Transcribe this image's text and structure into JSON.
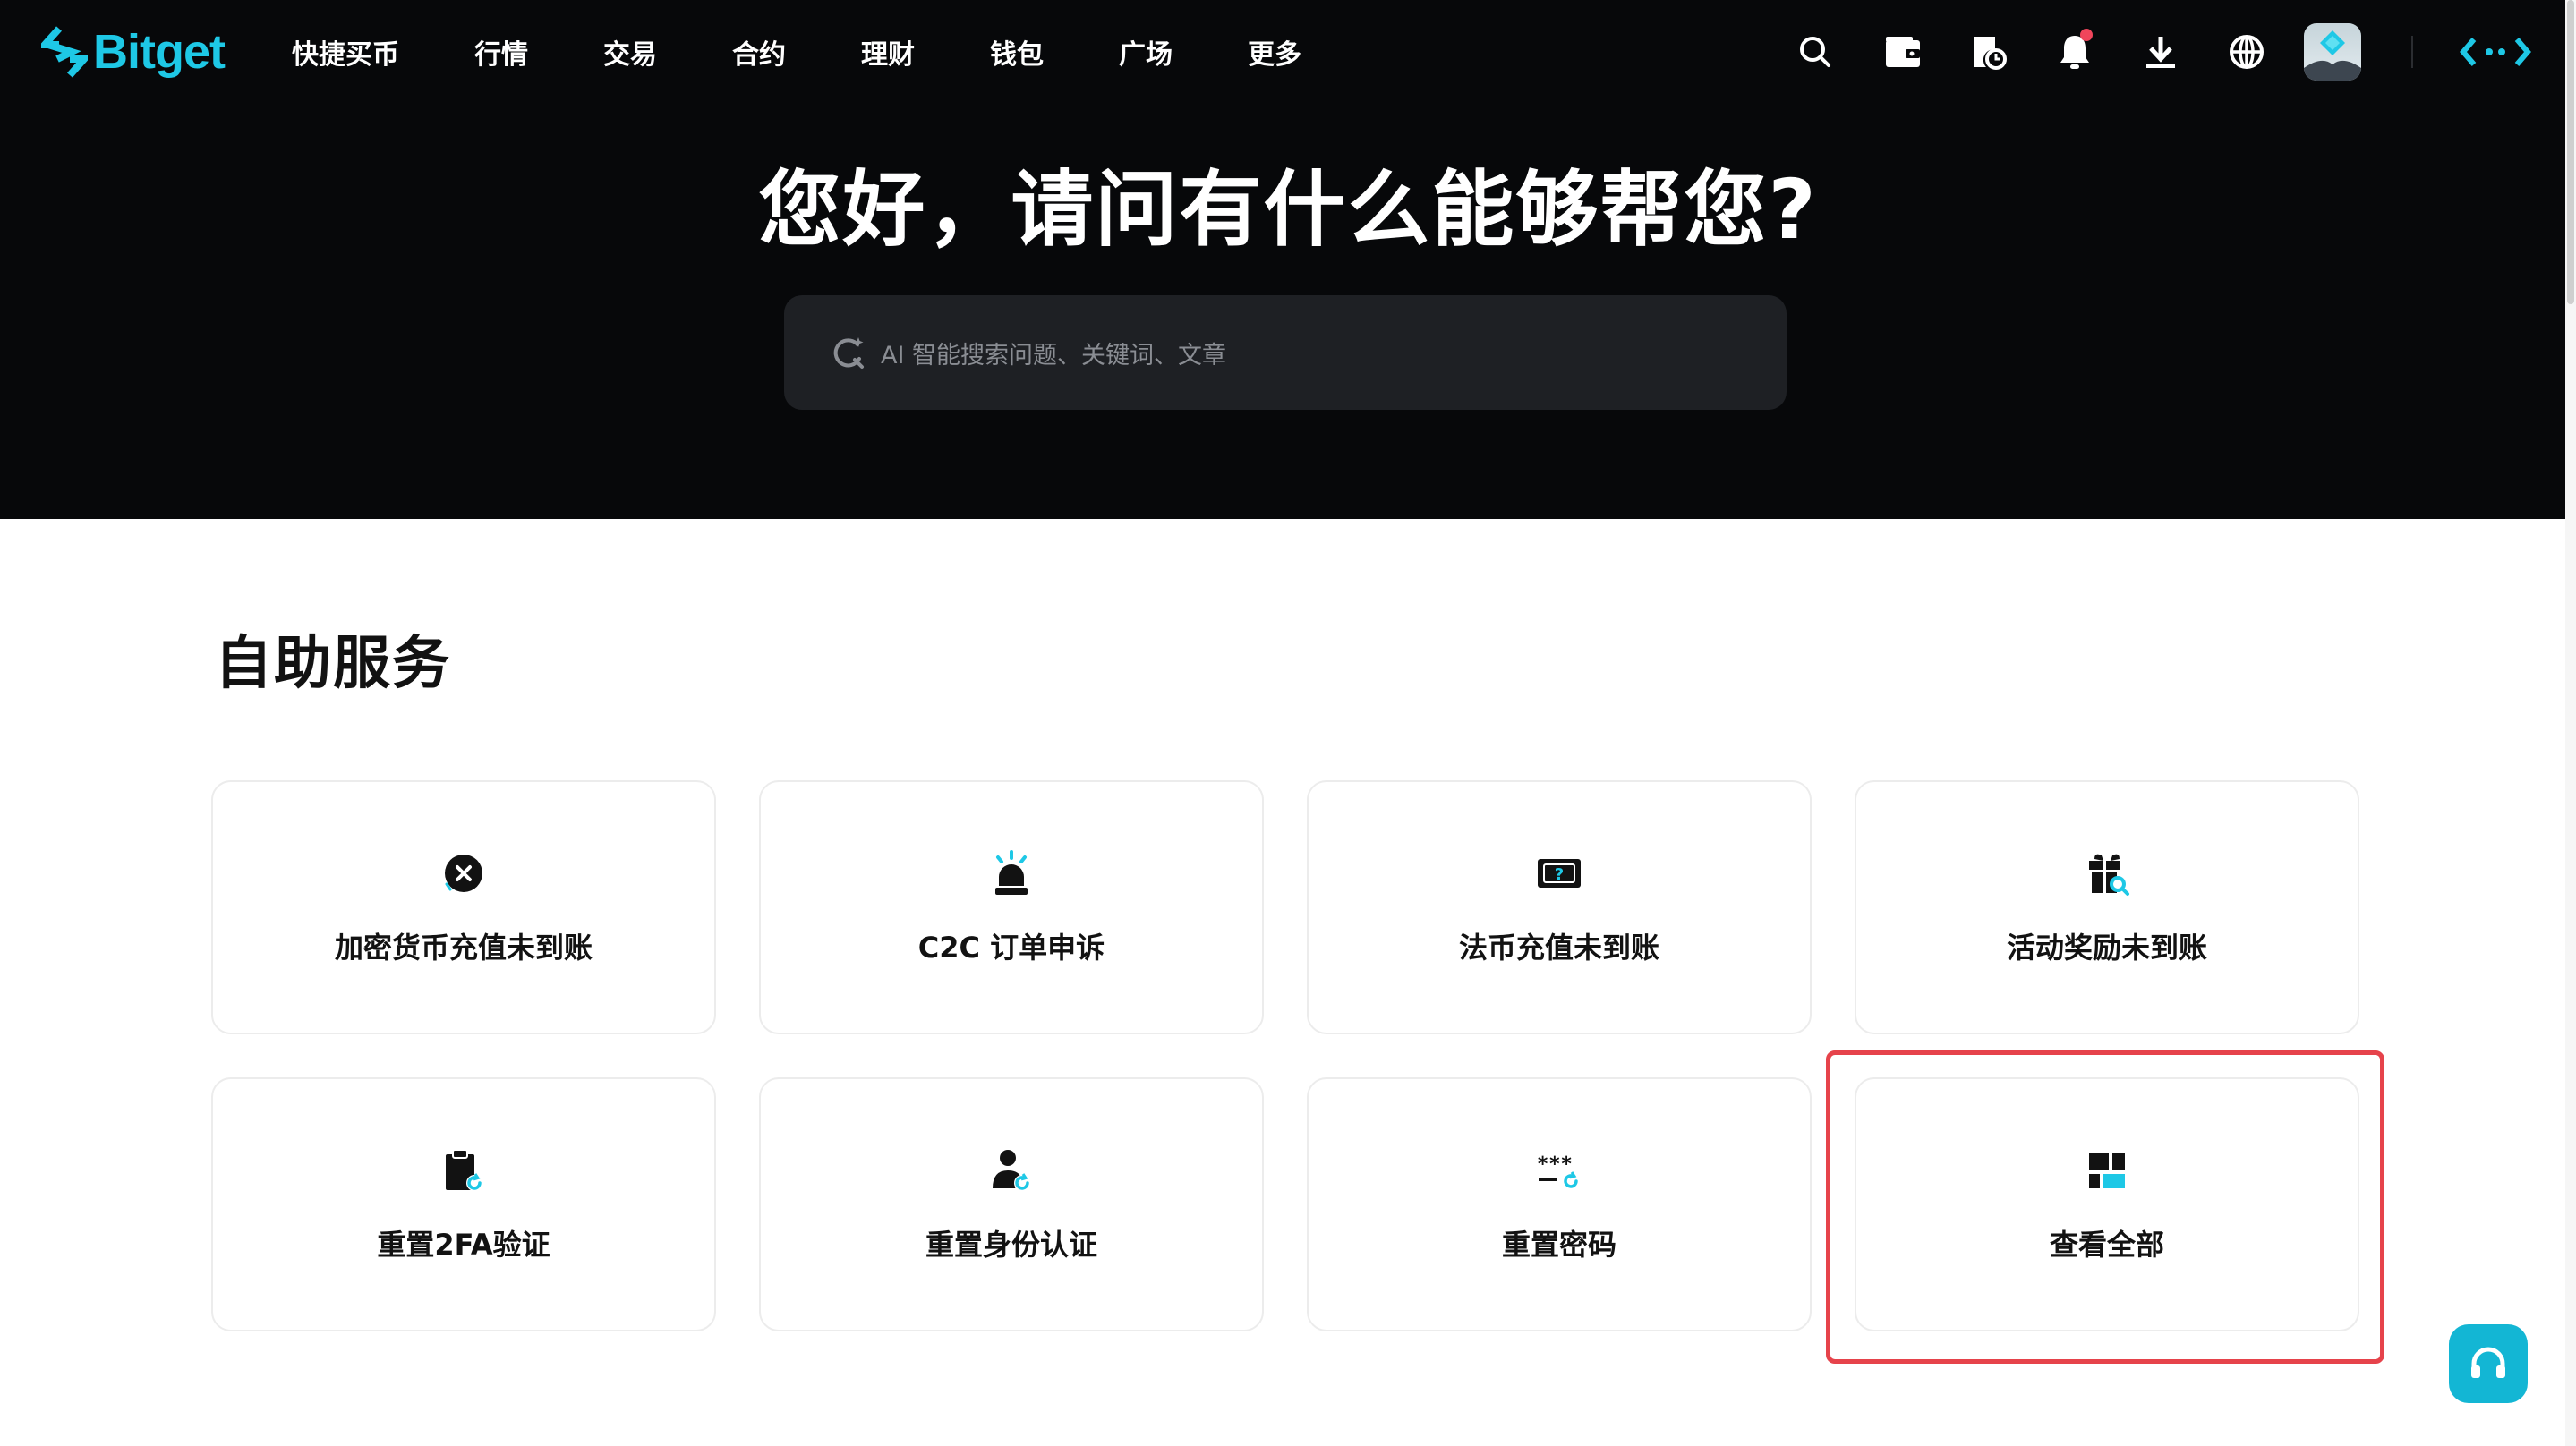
{
  "brand": {
    "name": "Bitget",
    "accent": "#1ec8e6"
  },
  "nav": {
    "items": [
      "快捷买币",
      "行情",
      "交易",
      "合约",
      "理财",
      "钱包",
      "广场",
      "更多"
    ],
    "icons": [
      "search-icon",
      "wallet-icon",
      "orders-icon",
      "bell-icon",
      "download-icon",
      "globe-icon",
      "avatar",
      "code-icon"
    ]
  },
  "hero": {
    "title": "您好，请问有什么能够帮您?",
    "search_placeholder": "AI 智能搜索问题、关键词、文章"
  },
  "self_service": {
    "title": "自助服务",
    "cards": [
      {
        "label": "加密货币充值未到账",
        "icon": "close-circle-icon"
      },
      {
        "label": "C2C 订单申诉",
        "icon": "alarm-icon"
      },
      {
        "label": "法币充值未到账",
        "icon": "cash-question-icon"
      },
      {
        "label": "活动奖励未到账",
        "icon": "gift-search-icon"
      },
      {
        "label": "重置2FA验证",
        "icon": "clipboard-refresh-icon"
      },
      {
        "label": "重置身份认证",
        "icon": "person-refresh-icon"
      },
      {
        "label": "重置密码",
        "icon": "password-refresh-icon"
      },
      {
        "label": "查看全部",
        "icon": "grid-icon"
      }
    ]
  },
  "colors": {
    "highlight": "#e6434b",
    "support_button": "#13b6d4"
  }
}
